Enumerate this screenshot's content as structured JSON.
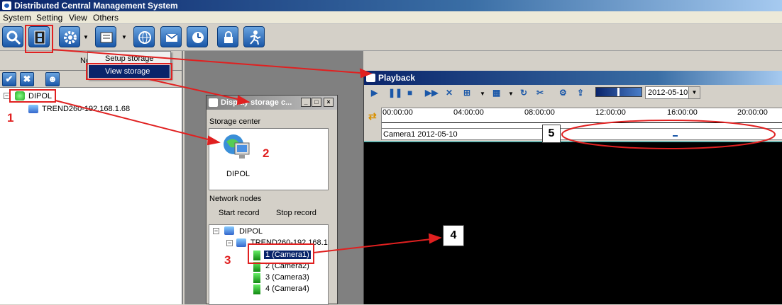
{
  "window": {
    "title": "Distributed Central Management System"
  },
  "menu": [
    "System",
    "Setting",
    "View",
    "Others"
  ],
  "toolbar_icons": [
    "search-icon",
    "playback-film-icon",
    "settings-gear-icon",
    "storage-icon",
    "network-globe-icon",
    "mail-icon",
    "clock-icon",
    "lock-icon",
    "user-run-icon"
  ],
  "left_pane": {
    "header_fragment": "No"
  },
  "dropdown_menu": {
    "items": [
      "Setup storage",
      "View storage"
    ],
    "selected": "View storage"
  },
  "tree_main": {
    "root": "DIPOL",
    "child": "TREND260-192.168.1.68"
  },
  "storage_window": {
    "title": "Display storage c...",
    "storage_center_label": "Storage center",
    "storage_item": "DIPOL",
    "network_nodes_label": "Network nodes",
    "start_record": "Start record",
    "stop_record": "Stop record",
    "tree_root": "DIPOL",
    "tree_node": "TREND260-192.168.1.",
    "cameras": [
      "1 (Camera1)",
      "2 (Camera2)",
      "3 (Camera3)",
      "4 (Camera4)"
    ]
  },
  "playback": {
    "title": "Playback",
    "date": "2012-05-10",
    "times": [
      "00:00:00",
      "04:00:00",
      "08:00:00",
      "12:00:00",
      "16:00:00",
      "20:00:00"
    ],
    "track_label": "Camera1 2012-05-10"
  },
  "annotations": [
    "1",
    "2",
    "3",
    "4",
    "5"
  ],
  "colors": {
    "title_gradient_start": "#0a246a",
    "annotation_red": "#e02020",
    "selection": "#0a246a"
  }
}
